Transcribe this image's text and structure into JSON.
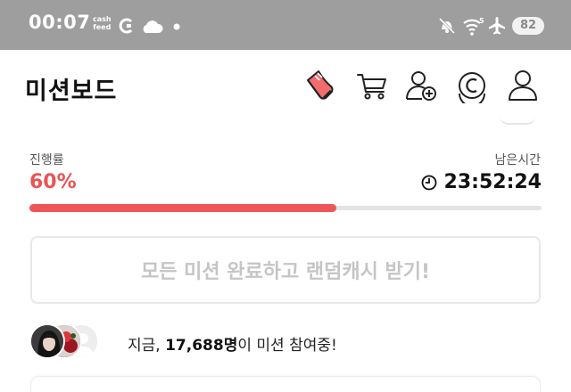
{
  "status_bar": {
    "time": "00:07",
    "cashfeed_line1": "cash",
    "cashfeed_line2": "feed",
    "battery": "82",
    "icons": [
      "cashfeed-icon",
      "c-app-icon",
      "cloud-icon",
      "dot-icon",
      "mute-icon",
      "wifi-icon",
      "airplane-icon",
      "battery-icon"
    ]
  },
  "header": {
    "title": "미션보드",
    "icons": [
      "shoe-icon",
      "cart-icon",
      "add-friend-icon",
      "coin-icon",
      "profile-icon"
    ],
    "accent_color": "#e95456"
  },
  "progress": {
    "label": "진행률",
    "percent_text": "60%",
    "value": 0.6,
    "remaining_label": "남은시간",
    "remaining_time": "23:52:24",
    "bar_color": "#ef5457",
    "track_color": "#e3e3e3"
  },
  "claim_button": {
    "label": "모든 미션 완료하고 랜덤캐시 받기!"
  },
  "participants": {
    "prefix": "지금, ",
    "count": "17,688명",
    "suffix": "이 미션 참여중!"
  }
}
